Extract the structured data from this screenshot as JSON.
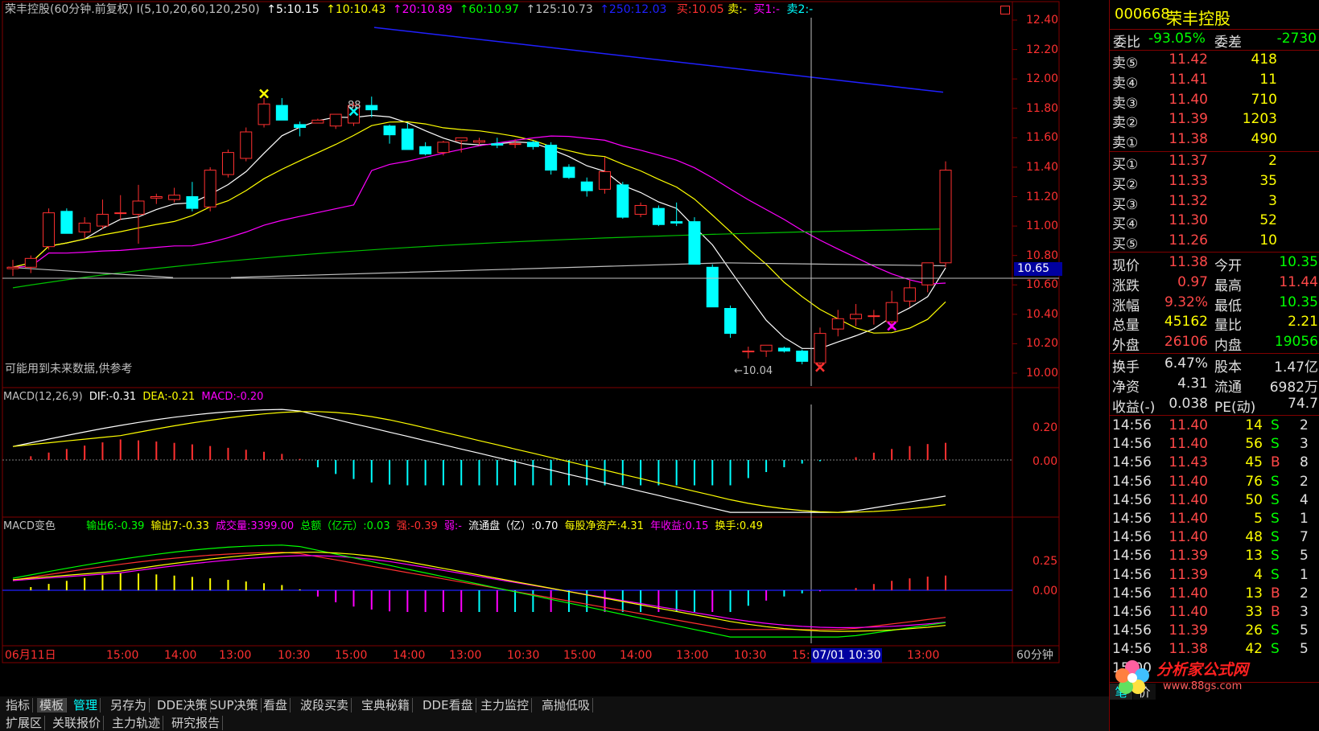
{
  "header": {
    "title": "荣丰控股(60分钟.前复权)",
    "ma_params": "I(5,10,20,60,120,250)",
    "ma5": "↑5:10.15",
    "ma10": "↑10:10.43",
    "ma20": "↑20:10.89",
    "ma60": "↑60:10.97",
    "ma125": "↑125:10.73",
    "ma250": "↑250:12.03",
    "sell": "买:10.05",
    "sell_b": "卖:-",
    "sell1": "买1:-",
    "sell2": "卖2:-"
  },
  "main": {
    "note": "可能用到未来数据,供参考",
    "low_mark": "←10.04",
    "high_mark": "88",
    "cross_price": "10.65",
    "price_ticks": [
      "12.40",
      "12.20",
      "12.00",
      "11.80",
      "11.60",
      "11.40",
      "11.20",
      "11.00",
      "10.80",
      "10.60",
      "10.40",
      "10.20",
      "10.00"
    ]
  },
  "macd": {
    "title": "MACD(12,26,9)",
    "dif": "DIF:-0.31",
    "dea": "DEA:-0.21",
    "macd": "MACD:-0.20",
    "ticks": [
      "0.20",
      "0.00"
    ]
  },
  "macd2": {
    "title": "MACD变色",
    "out6": "输出6:-0.39",
    "out7": "输出7:-0.33",
    "volume": "成交量:3399.00",
    "amount": "总额（亿元）:0.03",
    "strong": "强:-0.39",
    "weak": "弱:-",
    "float": "流通盘（亿）:0.70",
    "nav": "每股净资产:4.31",
    "eps": "年收益:0.15",
    "turnover": "换手:0.49",
    "ticks": [
      "0.25",
      "0.00"
    ]
  },
  "xaxis": {
    "labels": [
      "06月11日",
      "15:00",
      "14:00",
      "13:00",
      "10:30",
      "15:00",
      "14:00",
      "13:00",
      "10:30",
      "15:00",
      "14:00",
      "13:00",
      "10:30",
      "15:",
      "13:00"
    ],
    "cursor_label": "07/01 10:30",
    "period": "60分钟"
  },
  "toolbar1": [
    "指标",
    "模板",
    "管理",
    "另存为",
    "DDE决策",
    "SUP决策",
    "看盘",
    "波段买卖",
    "宝典秘籍",
    "DDE看盘",
    "主力监控",
    "高抛低吸"
  ],
  "toolbar2": [
    "扩展区",
    "关联报价",
    "主力轨迹",
    "研究报告"
  ],
  "quote": {
    "code": "000668",
    "name": "荣丰控股",
    "weibi_label": "委比",
    "weibi": "-93.05%",
    "weicha_label": "委差",
    "weicha": "-2730",
    "asks": [
      {
        "label": "卖⑤",
        "price": "11.42",
        "vol": "418"
      },
      {
        "label": "卖④",
        "price": "11.41",
        "vol": "11"
      },
      {
        "label": "卖③",
        "price": "11.40",
        "vol": "710"
      },
      {
        "label": "卖②",
        "price": "11.39",
        "vol": "1203"
      },
      {
        "label": "卖①",
        "price": "11.38",
        "vol": "490"
      }
    ],
    "bids": [
      {
        "label": "买①",
        "price": "11.37",
        "vol": "2"
      },
      {
        "label": "买②",
        "price": "11.33",
        "vol": "35"
      },
      {
        "label": "买③",
        "price": "11.32",
        "vol": "3"
      },
      {
        "label": "买④",
        "price": "11.30",
        "vol": "52"
      },
      {
        "label": "买⑤",
        "price": "11.26",
        "vol": "10"
      }
    ],
    "stats": [
      {
        "l1": "现价",
        "v1": "11.38",
        "l2": "今开",
        "v2": "10.35"
      },
      {
        "l1": "涨跌",
        "v1": "0.97",
        "l2": "最高",
        "v2": "11.44"
      },
      {
        "l1": "涨幅",
        "v1": "9.32%",
        "l2": "最低",
        "v2": "10.35"
      },
      {
        "l1": "总量",
        "v1": "45162",
        "l2": "量比",
        "v2": "2.21"
      },
      {
        "l1": "外盘",
        "v1": "26106",
        "l2": "内盘",
        "v2": "19056"
      }
    ],
    "stats2": [
      {
        "l1": "换手",
        "v1": "6.47%",
        "l2": "股本",
        "v2": "1.47亿"
      },
      {
        "l1": "净资",
        "v1": "4.31",
        "l2": "流通",
        "v2": "6982万"
      },
      {
        "l1": "收益(-)",
        "v1": "0.038",
        "l2": "PE(动)",
        "v2": "74.7"
      }
    ],
    "ticks": [
      {
        "t": "14:56",
        "p": "11.40",
        "v": "14",
        "bs": "S",
        "n": "2"
      },
      {
        "t": "14:56",
        "p": "11.40",
        "v": "56",
        "bs": "S",
        "n": "3"
      },
      {
        "t": "14:56",
        "p": "11.43",
        "v": "45",
        "bs": "B",
        "n": "8"
      },
      {
        "t": "14:56",
        "p": "11.40",
        "v": "76",
        "bs": "S",
        "n": "2"
      },
      {
        "t": "14:56",
        "p": "11.40",
        "v": "50",
        "bs": "S",
        "n": "4"
      },
      {
        "t": "14:56",
        "p": "11.40",
        "v": "5",
        "bs": "S",
        "n": "1"
      },
      {
        "t": "14:56",
        "p": "11.40",
        "v": "48",
        "bs": "S",
        "n": "7"
      },
      {
        "t": "14:56",
        "p": "11.39",
        "v": "13",
        "bs": "S",
        "n": "5"
      },
      {
        "t": "14:56",
        "p": "11.39",
        "v": "4",
        "bs": "S",
        "n": "1"
      },
      {
        "t": "14:56",
        "p": "11.40",
        "v": "13",
        "bs": "B",
        "n": "2"
      },
      {
        "t": "14:56",
        "p": "11.40",
        "v": "33",
        "bs": "B",
        "n": "3"
      },
      {
        "t": "14:56",
        "p": "11.39",
        "v": "26",
        "bs": "S",
        "n": "5"
      },
      {
        "t": "14:56",
        "p": "11.38",
        "v": "42",
        "bs": "S",
        "n": "5"
      },
      {
        "t": "15:00",
        "p": "",
        "v": "",
        "bs": "",
        "n": ""
      }
    ],
    "bottom_tabs": [
      "笔",
      "价"
    ],
    "brand": "分析家公式网",
    "brand_url": "www.88gs.com"
  },
  "candles": [
    [
      10.71,
      10.77,
      10.66,
      10.72
    ],
    [
      10.72,
      10.8,
      10.68,
      10.78
    ],
    [
      10.86,
      11.12,
      10.84,
      11.09
    ],
    [
      11.1,
      11.12,
      10.95,
      10.95
    ],
    [
      10.96,
      11.06,
      10.92,
      11.02
    ],
    [
      11.0,
      11.18,
      10.98,
      11.08
    ],
    [
      11.09,
      11.21,
      11.04,
      11.09
    ],
    [
      11.08,
      11.28,
      10.88,
      11.17
    ],
    [
      11.19,
      11.22,
      11.15,
      11.2
    ],
    [
      11.18,
      11.26,
      11.16,
      11.21
    ],
    [
      11.2,
      11.3,
      11.1,
      11.12
    ],
    [
      11.13,
      11.4,
      11.1,
      11.38
    ],
    [
      11.35,
      11.52,
      11.33,
      11.5
    ],
    [
      11.46,
      11.67,
      11.44,
      11.64
    ],
    [
      11.69,
      11.87,
      11.67,
      11.83
    ],
    [
      11.82,
      11.87,
      11.74,
      11.72
    ],
    [
      11.69,
      11.71,
      11.61,
      11.67
    ],
    [
      11.7,
      11.73,
      11.7,
      11.72
    ],
    [
      11.68,
      11.76,
      11.66,
      11.76
    ],
    [
      11.7,
      11.84,
      11.68,
      11.82
    ],
    [
      11.82,
      11.88,
      11.74,
      11.79
    ],
    [
      11.68,
      11.69,
      11.56,
      11.62
    ],
    [
      11.66,
      11.7,
      11.53,
      11.52
    ],
    [
      11.54,
      11.57,
      11.48,
      11.49
    ],
    [
      11.5,
      11.58,
      11.48,
      11.57
    ],
    [
      11.58,
      11.6,
      11.5,
      11.6
    ],
    [
      11.57,
      11.6,
      11.55,
      11.58
    ],
    [
      11.56,
      11.6,
      11.53,
      11.55
    ],
    [
      11.56,
      11.59,
      11.53,
      11.56
    ],
    [
      11.57,
      11.58,
      11.52,
      11.54
    ],
    [
      11.55,
      11.57,
      11.35,
      11.38
    ],
    [
      11.4,
      11.42,
      11.32,
      11.33
    ],
    [
      11.3,
      11.33,
      11.2,
      11.24
    ],
    [
      11.25,
      11.47,
      11.22,
      11.37
    ],
    [
      11.28,
      11.3,
      11.05,
      11.06
    ],
    [
      11.08,
      11.16,
      11.06,
      11.14
    ],
    [
      11.12,
      11.14,
      11.0,
      11.01
    ],
    [
      11.03,
      11.16,
      11.0,
      11.02
    ],
    [
      11.03,
      11.06,
      10.86,
      10.74
    ],
    [
      10.72,
      10.74,
      10.49,
      10.45
    ],
    [
      10.44,
      10.46,
      10.24,
      10.27
    ],
    [
      10.15,
      10.18,
      10.1,
      10.15
    ],
    [
      10.15,
      10.19,
      10.11,
      10.19
    ],
    [
      10.17,
      10.18,
      10.14,
      10.15
    ],
    [
      10.15,
      10.16,
      10.06,
      10.08
    ],
    [
      10.07,
      10.31,
      10.04,
      10.27
    ],
    [
      10.3,
      10.43,
      10.25,
      10.37
    ],
    [
      10.37,
      10.47,
      10.32,
      10.4
    ],
    [
      10.39,
      10.43,
      10.33,
      10.39
    ],
    [
      10.35,
      10.56,
      10.3,
      10.48
    ],
    [
      10.49,
      10.63,
      10.45,
      10.58
    ],
    [
      10.6,
      10.73,
      10.55,
      10.75
    ],
    [
      10.75,
      11.44,
      10.72,
      11.38
    ]
  ]
}
